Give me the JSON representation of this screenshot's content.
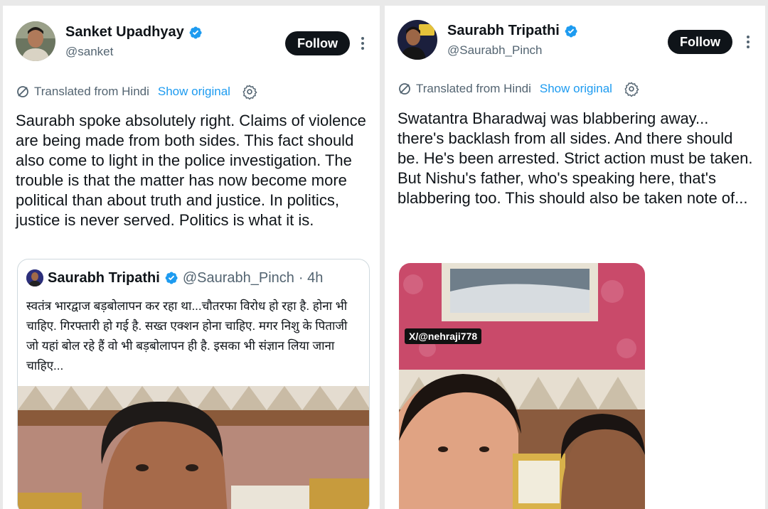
{
  "left": {
    "author": {
      "name": "Sanket Upadhyay",
      "handle": "@sanket"
    },
    "follow_label": "Follow",
    "translated_label": "Translated from Hindi",
    "show_original_label": "Show original",
    "body": "Saurabh spoke absolutely right. Claims of violence are being made from both sides. This fact should also come to light in the police investigation. The trouble is that the matter has now become more political than about truth and justice. In politics, justice is never served. Politics is what it is.",
    "quote": {
      "name": "Saurabh Tripathi",
      "handle": "@Saurabh_Pinch",
      "time": "· 4h",
      "text": "स्वतंत्र भारद्वाज बड़बोलापन कर रहा था...चौतरफा विरोध हो रहा है. होना भी चाहिए. गिरफ्तारी हो गई है. सख्त एक्शन होना चाहिए. मगर निशु के पिताजी जो यहां बोल रहे हैं वो भी बड़बोलापन ही है. इसका भी संज्ञान लिया जाना चाहिए..."
    }
  },
  "right": {
    "author": {
      "name": "Saurabh Tripathi",
      "handle": "@Saurabh_Pinch"
    },
    "follow_label": "Follow",
    "translated_label": "Translated from Hindi",
    "show_original_label": "Show original",
    "body": "Swatantra Bharadwaj was blabbering away... there's backlash from all sides. And there should be. He's been arrested. Strict action must be taken.\nBut Nishu's father, who's speaking here, that's blabbering too. This should also be taken note of...",
    "watermark": "X/@nehraji778"
  },
  "colors": {
    "accent": "#1d9bf0",
    "text": "#0f1419",
    "muted": "#536471",
    "follow_bg": "#0f1419"
  }
}
